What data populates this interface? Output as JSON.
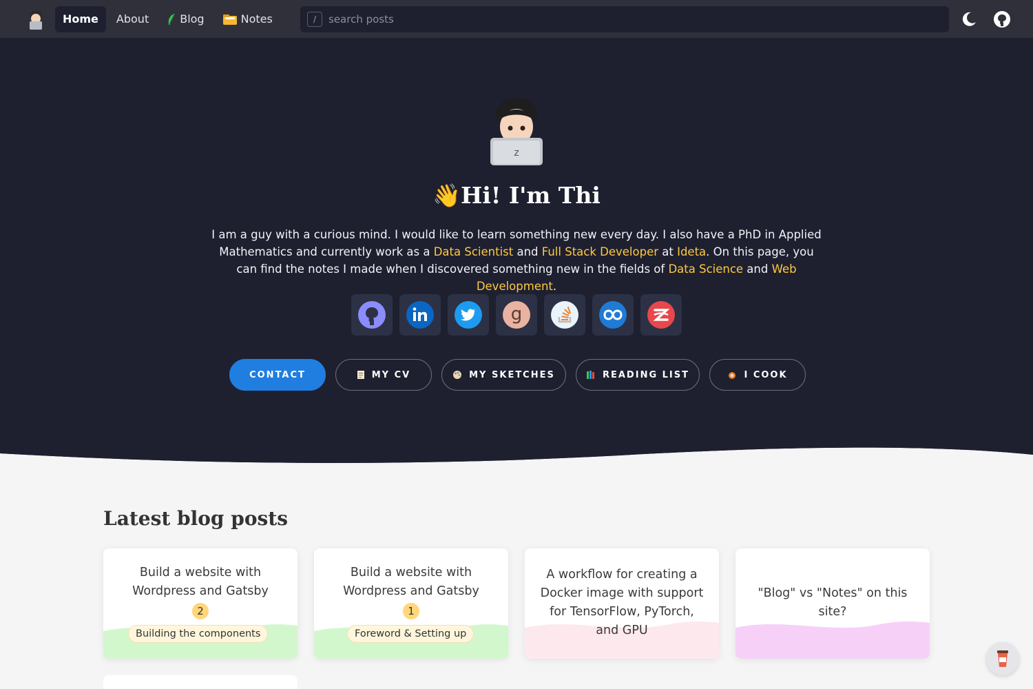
{
  "nav": {
    "items": [
      {
        "label": "Home",
        "active": true
      },
      {
        "label": "About",
        "active": false
      },
      {
        "label": "Blog",
        "icon": "feather-icon"
      },
      {
        "label": "Notes",
        "icon": "folder-icon"
      }
    ],
    "search": {
      "shortcut": "/",
      "placeholder": "search posts"
    },
    "right_icons": [
      "moon-icon",
      "github-icon"
    ]
  },
  "hero": {
    "wave_emoji": "👋",
    "title": "Hi! I'm Thi",
    "intro": {
      "p1": "I am a guy with a curious mind. I would like to learn something new every day. I also have a PhD in Applied Mathematics and currently work as a ",
      "l1": "Data Scientist",
      "p2": " and ",
      "l2": "Full Stack Developer",
      "p3": " at ",
      "l3": "Ideta",
      "p4": ". On this page, you can find the notes I made when I discovered something new in the fields of ",
      "l4": "Data Science",
      "p5": " and ",
      "l5": "Web Development",
      "p6": "."
    },
    "socials": [
      "github-icon",
      "linkedin-icon",
      "twitter-icon",
      "goodreads-icon",
      "stackoverflow-icon",
      "codeproject-icon",
      "zotero-icon"
    ],
    "buttons": [
      {
        "label": "CONTACT",
        "primary": true
      },
      {
        "label": "MY CV",
        "icon": "document-icon"
      },
      {
        "label": "MY SKETCHES",
        "icon": "palette-icon"
      },
      {
        "label": "READING LIST",
        "icon": "books-icon"
      },
      {
        "label": "I COOK",
        "icon": "cook-icon"
      }
    ]
  },
  "latest": {
    "title": "Latest blog posts",
    "cards": [
      {
        "title": "Build a website with Wordpress and Gatsby",
        "number": "2",
        "tag": "Building the components",
        "wave_color": "#c8f5c0"
      },
      {
        "title": "Build a website with Wordpress and Gatsby",
        "number": "1",
        "tag": "Foreword & Setting up",
        "wave_color": "#c8f5c0"
      },
      {
        "title": "A workflow for creating a Docker image with support for TensorFlow, PyTorch, and GPU",
        "wave_color": "#fde3e8"
      },
      {
        "title": "\"Blog\" vs \"Notes\" on this site?",
        "wave_color": "#f6c8f7"
      }
    ]
  },
  "colors": {
    "nav_bg": "#2f3039",
    "hero_bg": "#1e2030",
    "accent": "#1f7ee0",
    "highlight": "#ffc941",
    "page_bg": "#f5f5f5"
  }
}
